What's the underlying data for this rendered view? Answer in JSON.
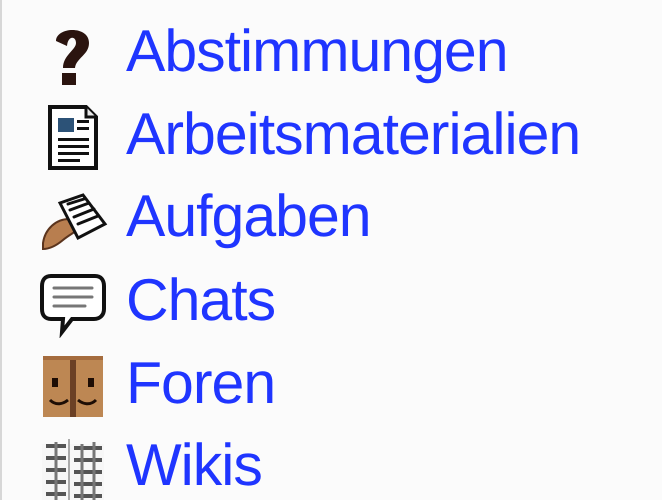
{
  "activities": [
    {
      "label": "Abstimmungen",
      "icon": "question-mark-icon"
    },
    {
      "label": "Arbeitsmaterialien",
      "icon": "document-icon"
    },
    {
      "label": "Aufgaben",
      "icon": "hand-paper-icon"
    },
    {
      "label": "Chats",
      "icon": "speech-bubble-icon"
    },
    {
      "label": "Foren",
      "icon": "people-faces-icon"
    },
    {
      "label": "Wikis",
      "icon": "wiki-grid-icon"
    }
  ],
  "colors": {
    "link": "#1f35ff",
    "background": "#fbfbfb",
    "border": "#d7d7d7",
    "icon_dark": "#2a1a14",
    "icon_brown": "#b87e4f"
  }
}
